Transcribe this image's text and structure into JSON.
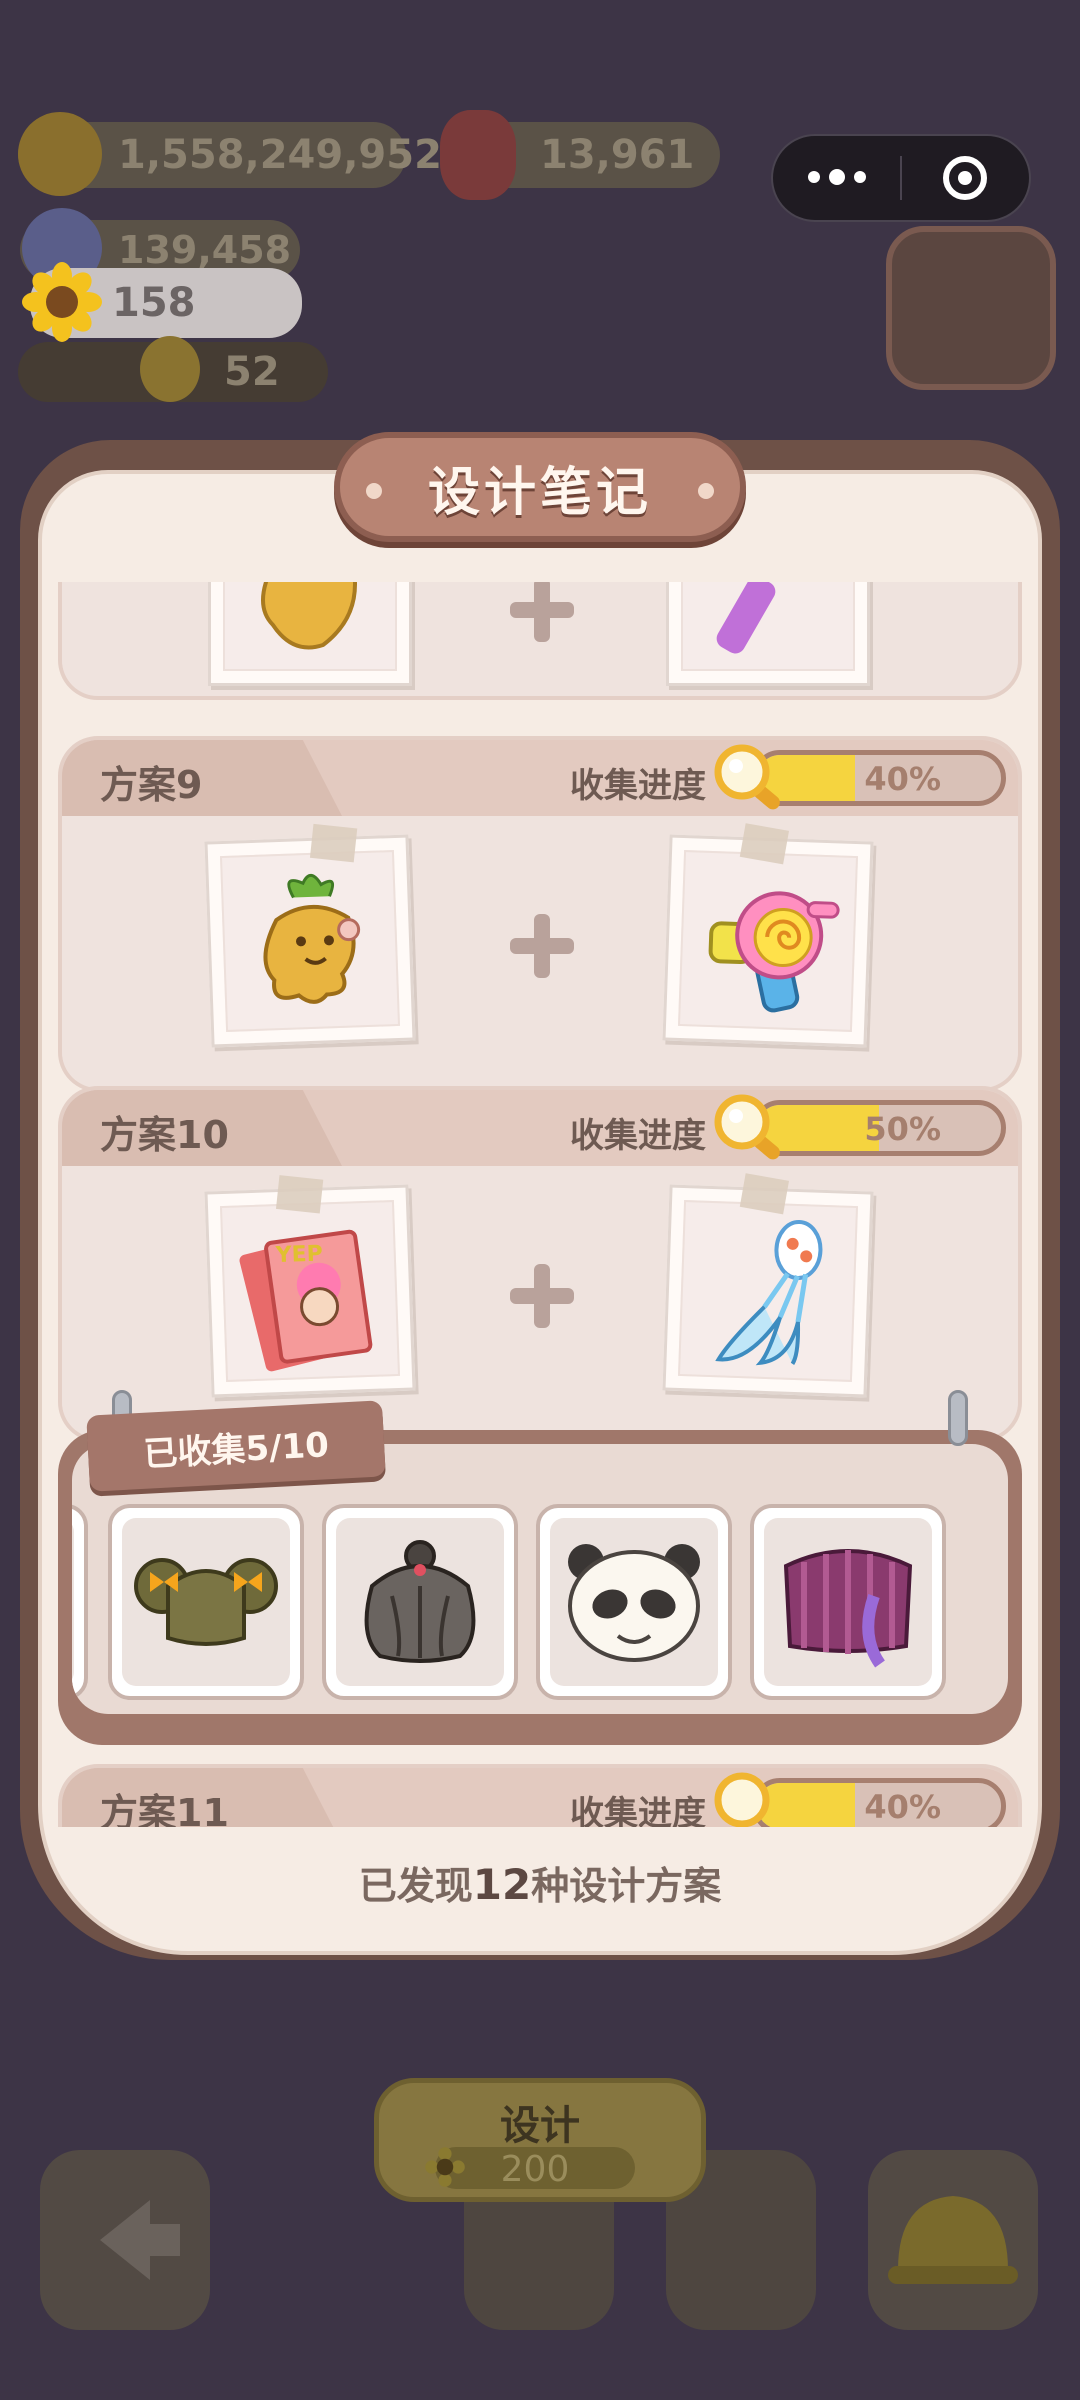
{
  "hud": {
    "coins": "1,558,249,952",
    "berries": "13,961",
    "gems": "139,458",
    "sunflowers": "158",
    "chicks": "52"
  },
  "panel": {
    "title": "设计笔记",
    "footer_prefix": "已发现",
    "footer_count": "12",
    "footer_suffix": "种设计方案"
  },
  "plans": [
    {
      "name": "方案9",
      "progress_label": "收集进度",
      "progress_text": "40%",
      "progress": 0.4,
      "item_a": "mandrake",
      "item_b": "candy-blaster"
    },
    {
      "name": "方案10",
      "progress_label": "收集进度",
      "progress_text": "50%",
      "progress": 0.5,
      "item_a": "photo-cards",
      "item_b": "whisk-wand"
    },
    {
      "name": "方案11",
      "progress_label": "收集进度",
      "progress_text": "40%",
      "progress": 0.4
    }
  ],
  "collected": {
    "label": "已收集5/10",
    "items": [
      "twin-buns-hair-icon",
      "messy-hair-icon",
      "panda-mask-icon",
      "purple-fan-icon"
    ]
  },
  "design_button": {
    "label": "设计",
    "cost": "200"
  },
  "colors": {
    "progress_fill": "#f5d43f",
    "panel_bg": "#f6ece4",
    "frame": "#6e5147"
  }
}
